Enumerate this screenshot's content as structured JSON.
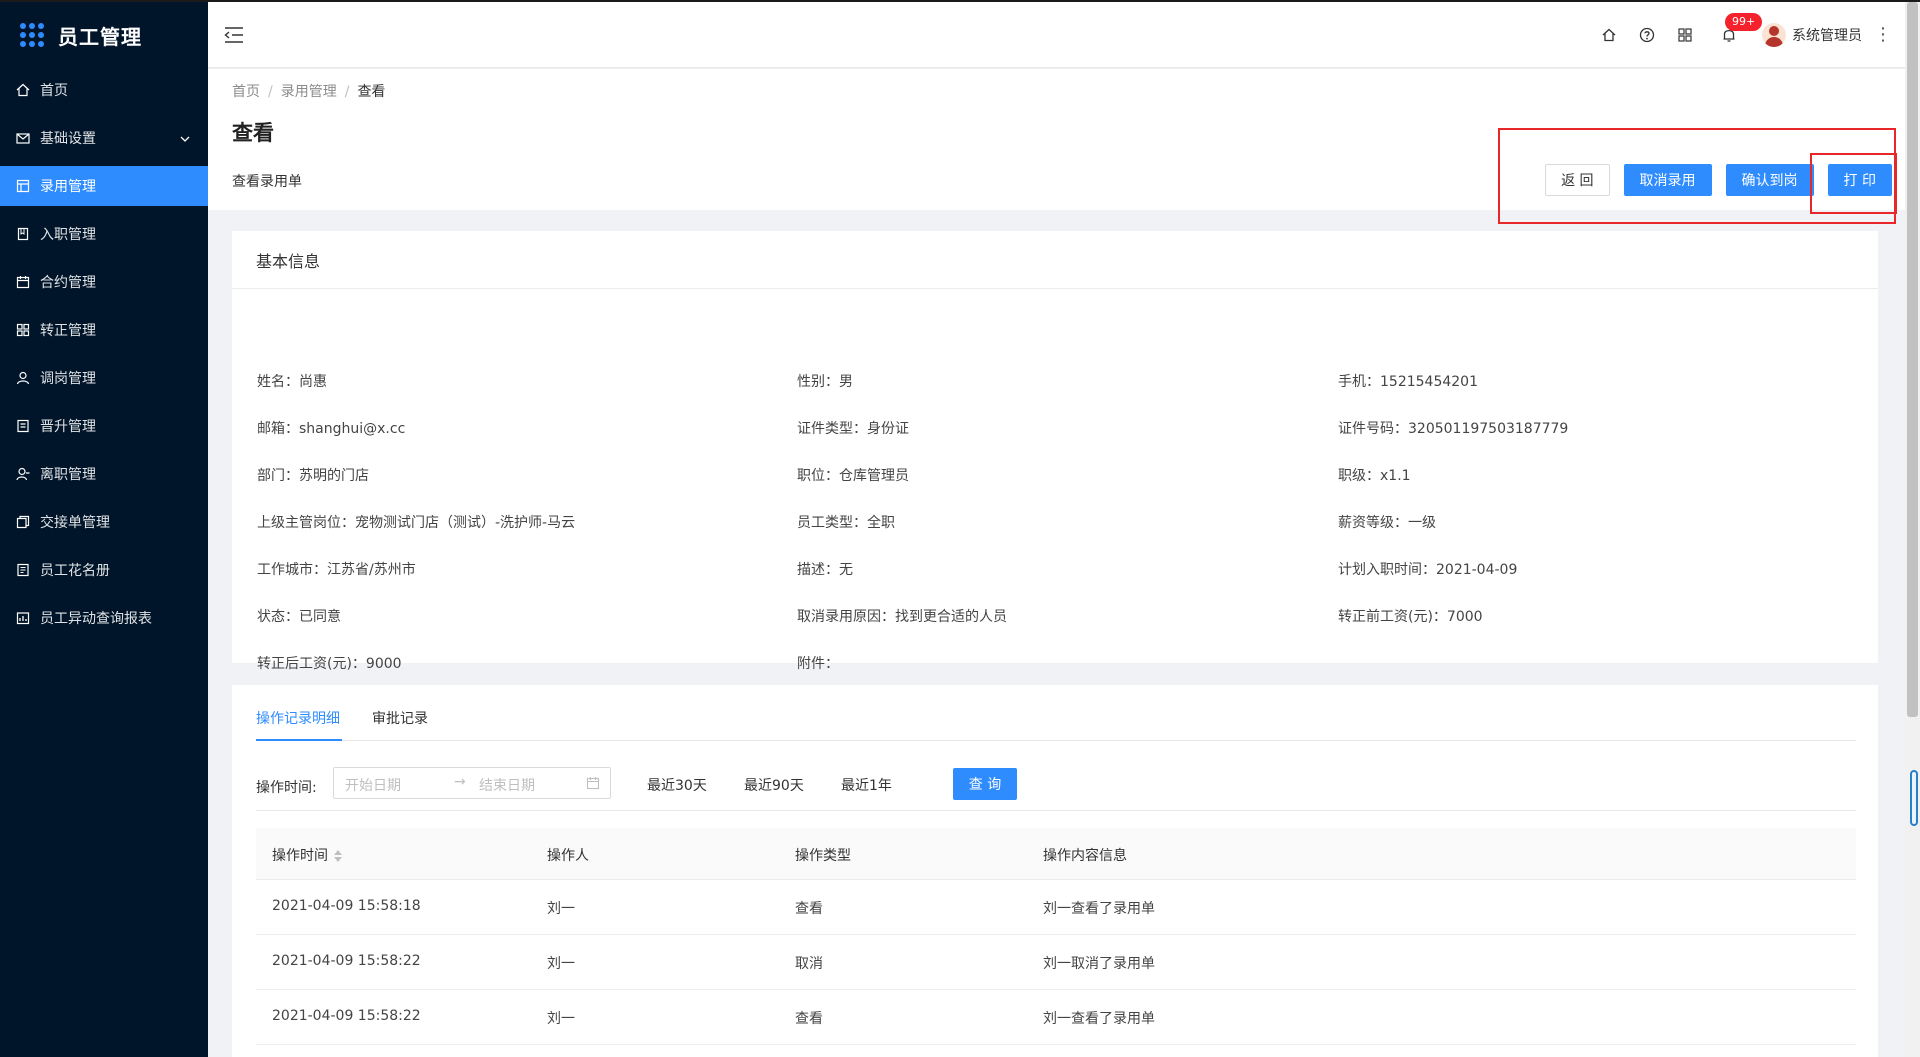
{
  "app": {
    "title": "员工管理"
  },
  "sidebar": {
    "items": [
      {
        "label": "首页",
        "icon": "home-icon"
      },
      {
        "label": "基础设置",
        "icon": "mail-icon"
      },
      {
        "label": "录用管理",
        "icon": "table-icon"
      },
      {
        "label": "入职管理",
        "icon": "book-icon"
      },
      {
        "label": "合约管理",
        "icon": "calendar-icon"
      },
      {
        "label": "转正管理",
        "icon": "grid-icon"
      },
      {
        "label": "调岗管理",
        "icon": "user-icon"
      },
      {
        "label": "晋升管理",
        "icon": "file-icon"
      },
      {
        "label": "离职管理",
        "icon": "user-leave-icon"
      },
      {
        "label": "交接单管理",
        "icon": "copy-icon"
      },
      {
        "label": "员工花名册",
        "icon": "roster-icon"
      },
      {
        "label": "员工异动查询报表",
        "icon": "report-icon"
      }
    ],
    "active_index": 2
  },
  "header": {
    "notification_badge": "99+",
    "username": "系统管理员"
  },
  "breadcrumb": [
    "首页",
    "录用管理",
    "查看"
  ],
  "page": {
    "title": "查看",
    "subtitle": "查看录用单"
  },
  "actions": {
    "back": "返 回",
    "cancel_hire": "取消录用",
    "confirm_arrival": "确认到岗",
    "print": "打 印"
  },
  "basic_info": {
    "title": "基本信息",
    "fields": [
      "姓名：尚惠",
      "性别：男",
      "手机：15215454201",
      "邮箱：shanghui@x.cc",
      "证件类型：身份证",
      "证件号码：320501197503187779",
      "部门：苏明的门店",
      "职位：仓库管理员",
      "职级：x1.1",
      "上级主管岗位：宠物测试门店（测试）-洗护师-马云",
      "员工类型：全职",
      "薪资等级：一级",
      "工作城市：江苏省/苏州市",
      "描述：无",
      "计划入职时间：2021-04-09",
      "状态：已同意",
      "取消录用原因：找到更合适的人员",
      "转正前工资(元)：7000",
      "转正后工资(元)：9000",
      "附件："
    ]
  },
  "records": {
    "tabs": [
      "操作记录明细",
      "审批记录"
    ],
    "filter": {
      "label": "操作时间:",
      "start_placeholder": "开始日期",
      "end_placeholder": "结束日期",
      "quick": [
        "最近30天",
        "最近90天",
        "最近1年"
      ],
      "query": "查 询"
    },
    "columns": [
      "操作时间",
      "操作人",
      "操作类型",
      "操作内容信息"
    ],
    "rows": [
      [
        "2021-04-09 15:58:18",
        "刘一",
        "查看",
        "刘一查看了录用单"
      ],
      [
        "2021-04-09 15:58:22",
        "刘一",
        "取消",
        "刘一取消了录用单"
      ],
      [
        "2021-04-09 15:58:22",
        "刘一",
        "查看",
        "刘一查看了录用单"
      ]
    ]
  },
  "colors": {
    "primary": "#2f8cff",
    "sidebar": "#001529",
    "highlight": "#e8272a"
  }
}
